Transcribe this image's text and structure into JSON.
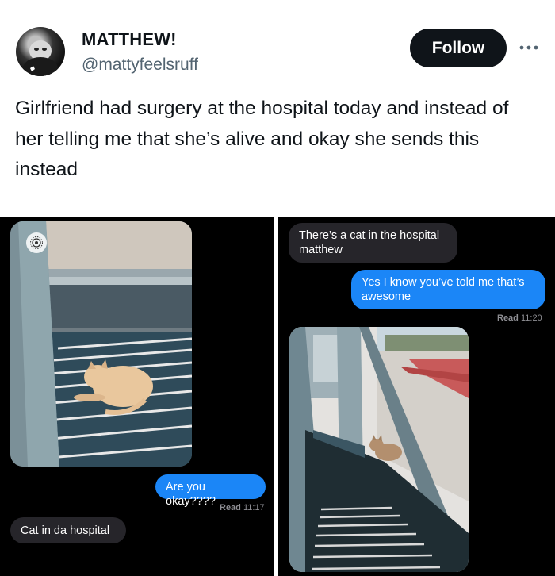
{
  "tweet": {
    "author_name": "MATTHEW!",
    "author_handle": "@mattyfeelsruff",
    "follow_label": "Follow",
    "more_icon": "more-horizontal-icon",
    "text": "Girlfriend had surgery at the hospital today and instead of her telling me that she’s alive and okay she sends this instead"
  },
  "left_screenshot": {
    "photo_icon": "live-photo-icon",
    "messages": [
      {
        "side": "sent",
        "text": "Are you okay????"
      },
      {
        "side": "received",
        "text": "Cat in da hospital"
      }
    ],
    "read_label": "Read",
    "read_time": "11:17"
  },
  "right_screenshot": {
    "messages": [
      {
        "side": "received",
        "text": "There’s a cat in the hospital matthew"
      },
      {
        "side": "sent",
        "text": "Yes I know you’ve told me that’s awesome"
      }
    ],
    "read_label": "Read",
    "read_time": "11:20"
  },
  "colors": {
    "follow_bg": "#0f1419",
    "sent_bubble": "#1b86f7",
    "received_bubble": "#26252a",
    "chat_bg": "#000000",
    "handle": "#536471"
  }
}
